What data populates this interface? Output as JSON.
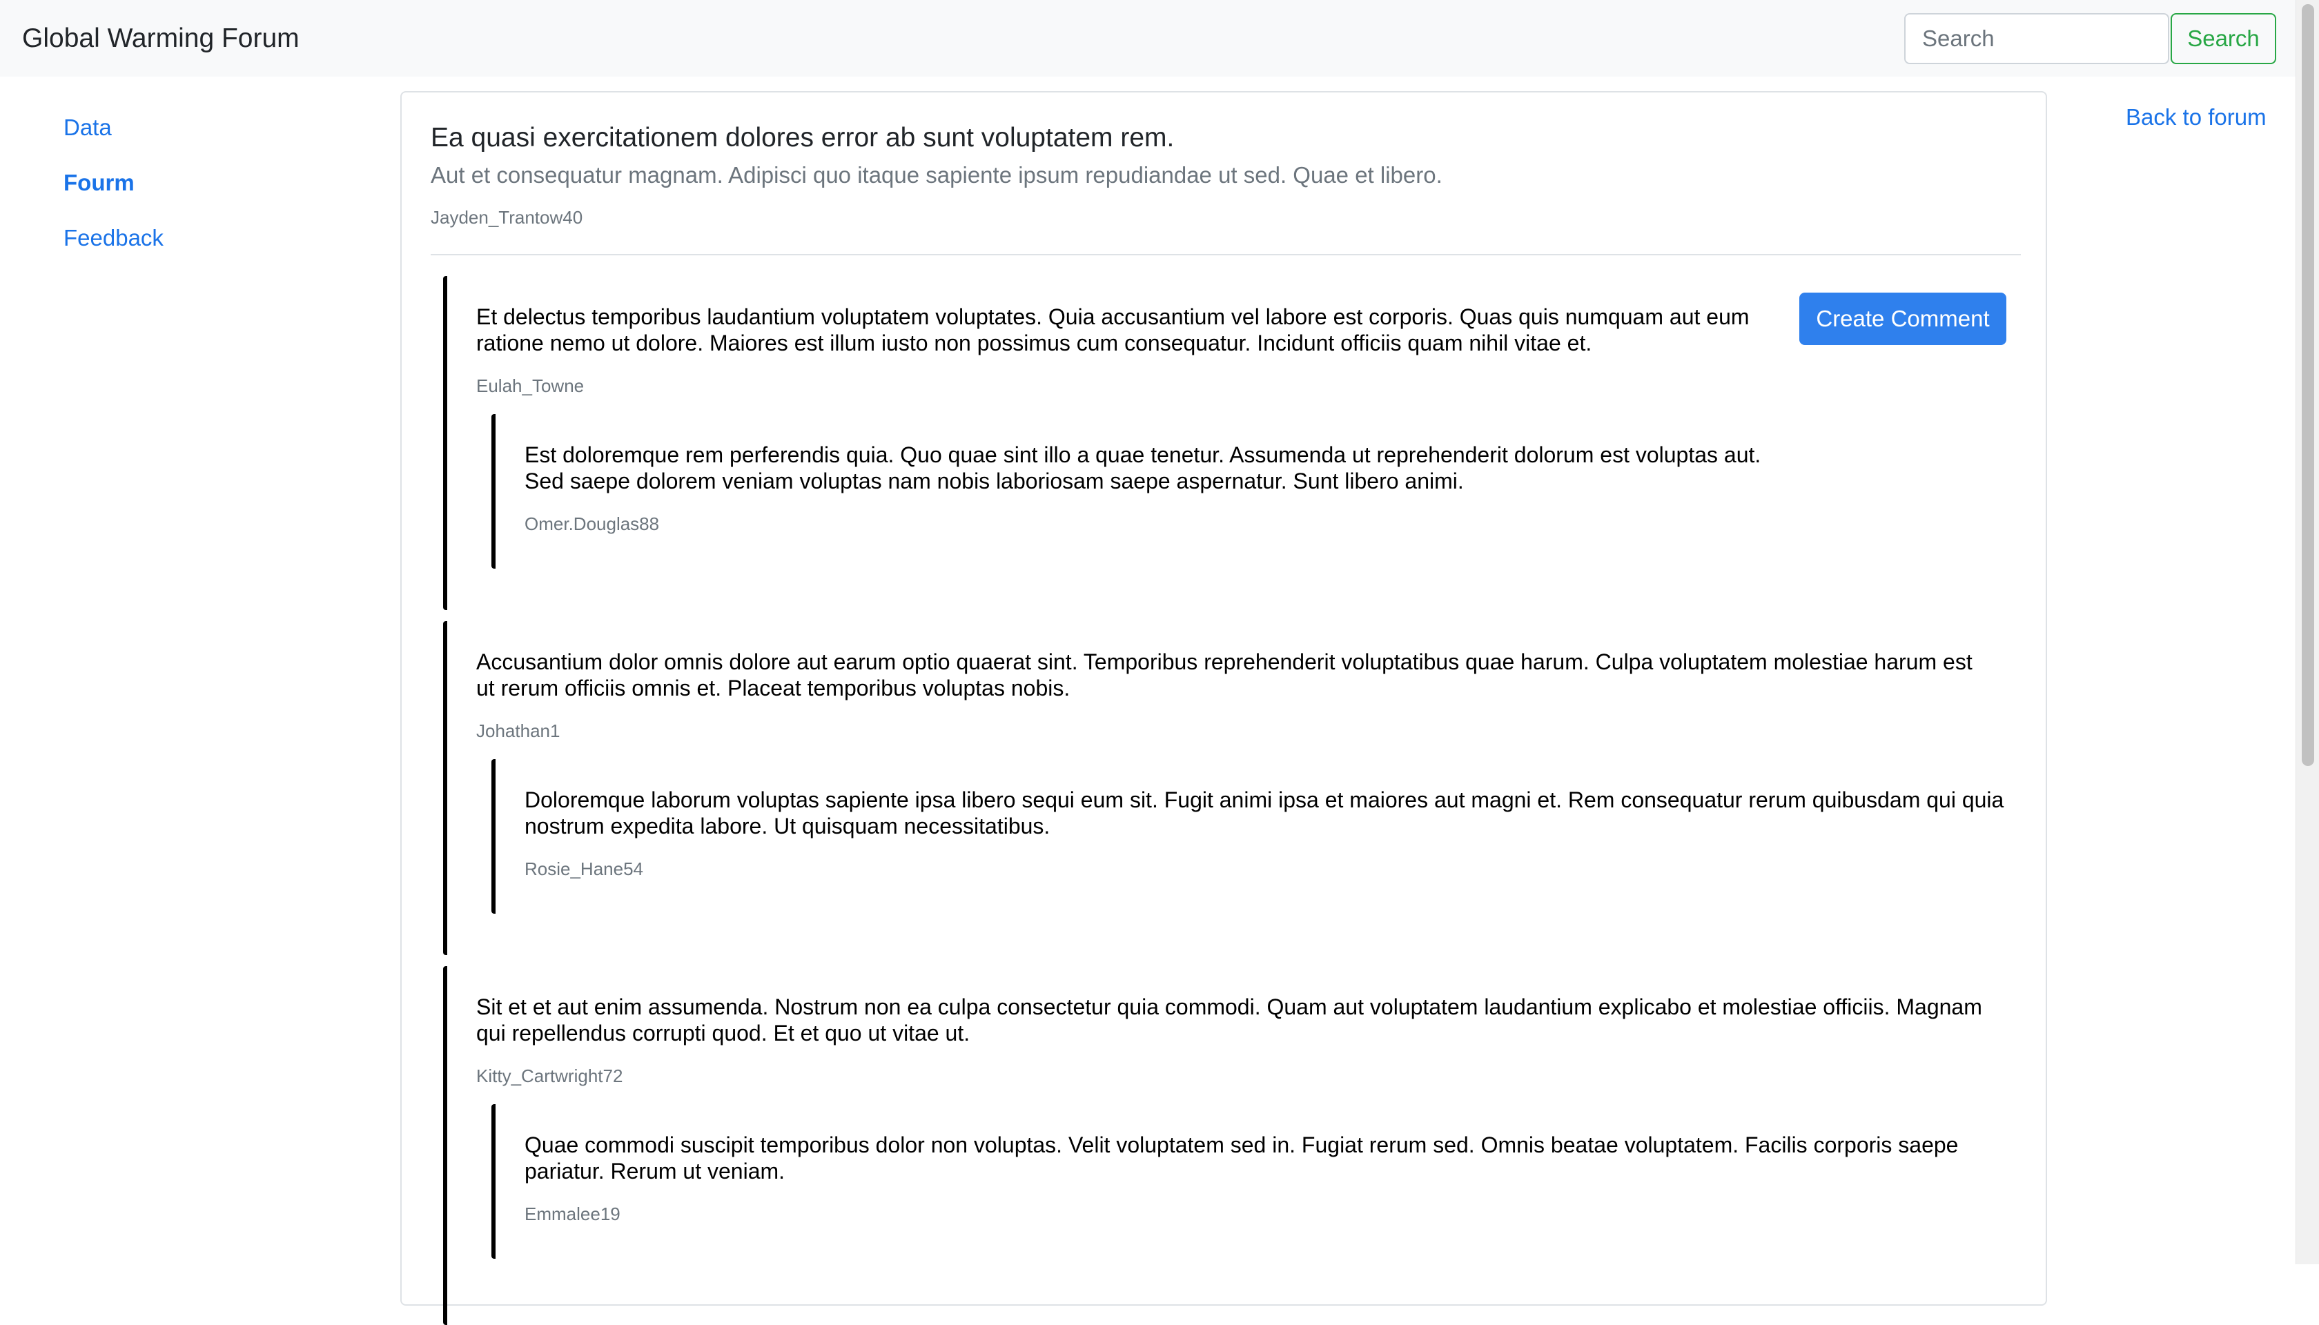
{
  "navbar": {
    "brand": "Global Warming Forum",
    "search_placeholder": "Search",
    "search_button": "Search"
  },
  "sidebar": {
    "items": [
      {
        "label": "Data",
        "active": false
      },
      {
        "label": "Fourm",
        "active": true
      },
      {
        "label": "Feedback",
        "active": false
      }
    ]
  },
  "back_link": "Back to forum",
  "post": {
    "title": "Ea quasi exercitationem dolores error ab sunt voluptatem rem.",
    "subtitle": "Aut et consequatur magnam. Adipisci quo itaque sapiente ipsum repudiandae ut sed. Quae et libero.",
    "author": "Jayden_Trantow40"
  },
  "create_comment_label": "Create Comment",
  "comments": [
    {
      "text": "Et delectus temporibus laudantium voluptatem voluptates. Quia accusantium vel labore est corporis. Quas quis numquam aut eum ratione nemo ut dolore. Maiores est illum iusto non possimus cum consequatur. Incidunt officiis quam nihil vitae et.",
      "author": "Eulah_Towne",
      "reply": {
        "text": "Est doloremque rem perferendis quia. Quo quae sint illo a quae tenetur. Assumenda ut reprehenderit dolorum est voluptas aut. Sed saepe dolorem veniam voluptas nam nobis laboriosam saepe aspernatur. Sunt libero animi.",
        "author": "Omer.Douglas88"
      }
    },
    {
      "text": "Accusantium dolor omnis dolore aut earum optio quaerat sint. Temporibus reprehenderit voluptatibus quae harum. Culpa voluptatem molestiae harum est ut rerum officiis omnis et. Placeat temporibus voluptas nobis.",
      "author": "Johathan1",
      "reply": {
        "text": "Doloremque laborum voluptas sapiente ipsa libero sequi eum sit. Fugit animi ipsa et maiores aut magni et. Rem consequatur rerum quibusdam qui quia nostrum expedita labore. Ut quisquam necessitatibus.",
        "author": "Rosie_Hane54"
      }
    },
    {
      "text": "Sit et et aut enim assumenda. Nostrum non ea culpa consectetur quia commodi. Quam aut voluptatem laudantium explicabo et molestiae officiis. Magnam qui repellendus corrupti quod. Et et quo ut vitae ut.",
      "author": "Kitty_Cartwright72",
      "reply": {
        "text": "Quae commodi suscipit temporibus dolor non voluptas. Velit voluptatem sed in. Fugiat rerum sed. Omnis beatae voluptatem. Facilis corporis saepe pariatur. Rerum ut veniam.",
        "author": "Emmalee19"
      }
    }
  ],
  "colors": {
    "link": "#1a73e8",
    "primary_button": "#2f80ed",
    "success": "#28a745",
    "muted_text": "#6c757d",
    "navbar_bg": "#f8f9fa"
  }
}
